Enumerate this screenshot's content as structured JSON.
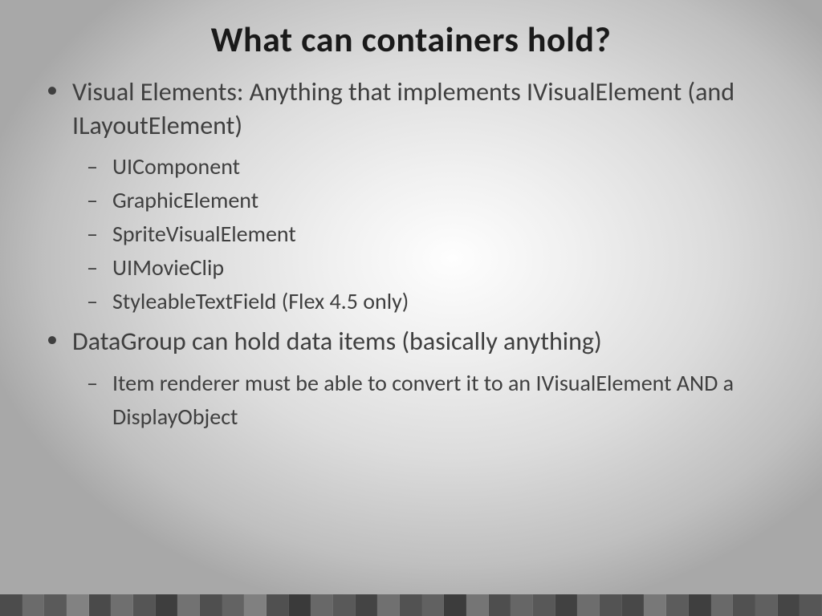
{
  "title": "What can containers hold?",
  "bullets": [
    {
      "text": "Visual Elements: Anything that implements IVisualElement (and ILayoutElement)",
      "sub": [
        "UIComponent",
        "GraphicElement",
        "SpriteVisualElement",
        "UIMovieClip",
        "StyleableTextField (Flex 4.5 only)"
      ]
    },
    {
      "text": "DataGroup can hold data items (basically anything)",
      "sub": [
        "Item renderer must be able to convert it to an IVisualElement AND a DisplayObject"
      ]
    }
  ],
  "squares": [
    "#4c4c4c",
    "#6b6b6b",
    "#5a5a5a",
    "#828282",
    "#4a4a4a",
    "#6f6f6f",
    "#555555",
    "#3e3e3e",
    "#727272",
    "#4f4f4f",
    "#636363",
    "#808080",
    "#505050",
    "#3a3a3a",
    "#686868",
    "#595959",
    "#444444",
    "#707070",
    "#525252",
    "#616161",
    "#3c3c3c",
    "#757575",
    "#4e4e4e",
    "#666666",
    "#585858",
    "#414141",
    "#6d6d6d",
    "#535353",
    "#484848",
    "#787878",
    "#5c5c5c",
    "#3f3f3f",
    "#696969",
    "#515151",
    "#606060",
    "#454545",
    "#565656"
  ]
}
